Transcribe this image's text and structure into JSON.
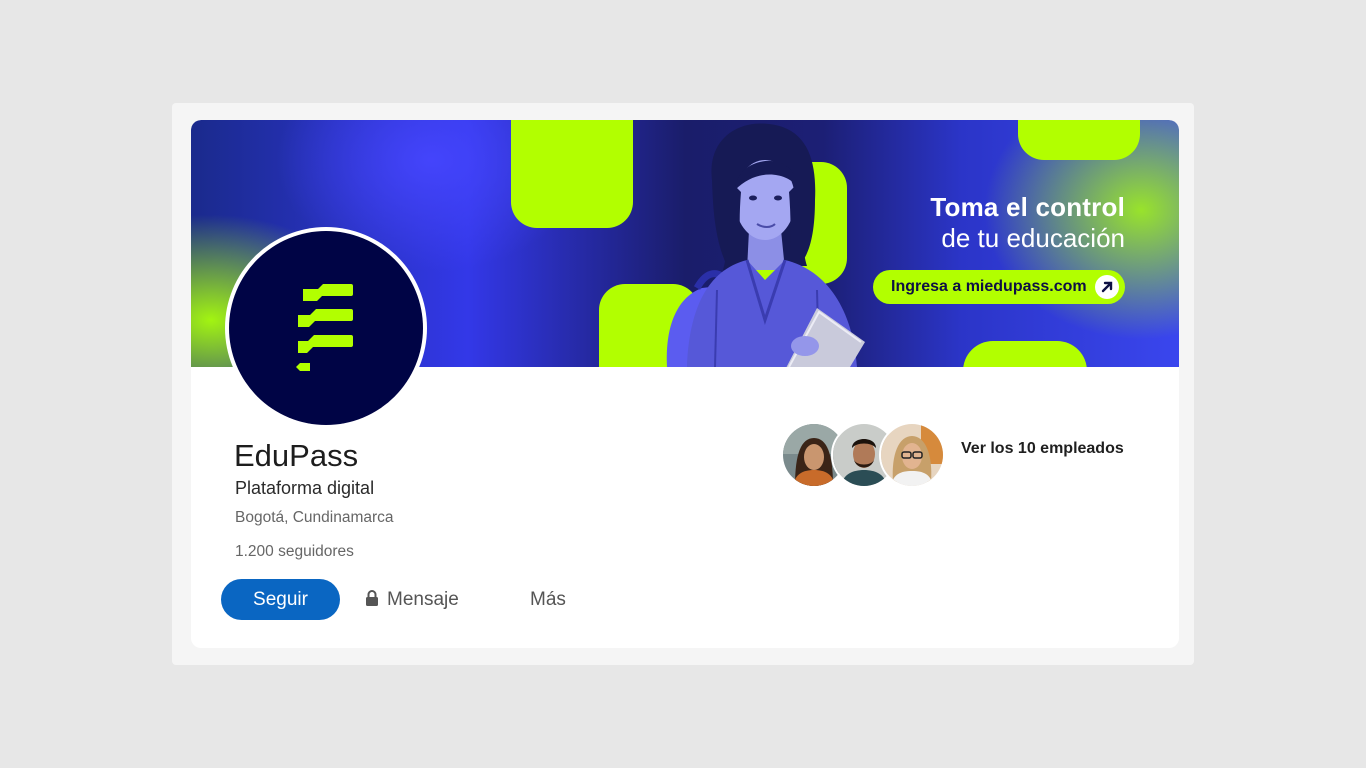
{
  "company": {
    "name": "EduPass",
    "tagline": "Plataforma digital",
    "location": "Bogotá, Cundinamarca",
    "followers": "1.200 seguidores"
  },
  "banner": {
    "headline_line1": "Toma el control",
    "headline_line2": "de tu educación",
    "cta_label": "Ingresa a miedupass.com",
    "cta_icon": "arrow-up-right-icon"
  },
  "actions": {
    "follow_label": "Seguir",
    "message_label": "Mensaje",
    "message_icon": "lock-icon",
    "more_label": "Más"
  },
  "employees": {
    "link_label": "Ver los 10 empleados"
  },
  "colors": {
    "accent_lime": "#b2ff00",
    "brand_navy": "#000445",
    "follow_blue": "#0a66c2",
    "banner_blue": "#3338e8"
  }
}
